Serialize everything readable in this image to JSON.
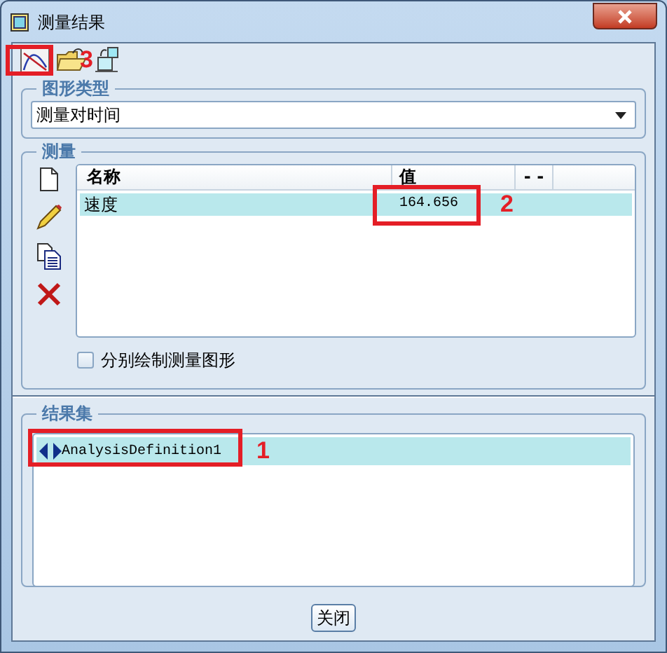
{
  "window": {
    "title": "测量结果"
  },
  "graph_type": {
    "label": "图形类型",
    "value": "测量对时间"
  },
  "measures": {
    "label": "测量",
    "columns": [
      "名称",
      "值",
      "- -"
    ],
    "rows": [
      {
        "cells": [
          "速度",
          "164.656"
        ],
        "selected": true
      }
    ],
    "separate_plot": {
      "label": "分别绘制测量图形",
      "checked": false
    }
  },
  "result_set": {
    "label": "结果集",
    "items": [
      {
        "name": "AnalysisDefinition1",
        "selected": true
      }
    ]
  },
  "buttons": [
    "关闭"
  ],
  "annotations": [
    {
      "kind": "toolbar",
      "number": "3"
    },
    {
      "kind": "value",
      "number": "2"
    },
    {
      "kind": "result",
      "number": "1"
    }
  ]
}
